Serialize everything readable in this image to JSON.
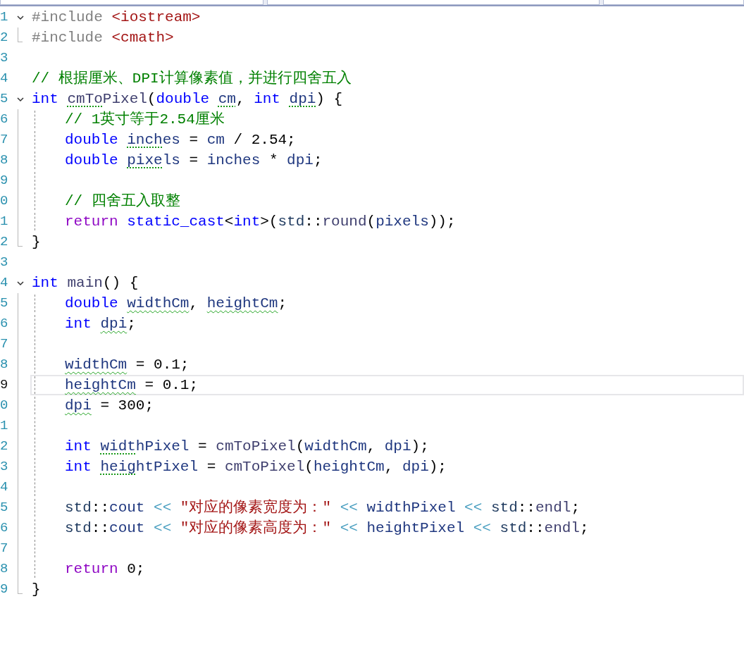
{
  "lines": [
    {
      "number": "1",
      "current": false,
      "expanded": true,
      "tokens": [
        {
          "kind": "pre",
          "text": "#include "
        },
        {
          "kind": "inc",
          "text": "<iostream>"
        }
      ],
      "children": [
        {
          "number": "2",
          "current": false,
          "tokens": [
            {
              "kind": "pre",
              "text": "#include "
            },
            {
              "kind": "inc",
              "text": "<cmath>"
            }
          ]
        }
      ]
    },
    {
      "number": "3",
      "current": false
    },
    {
      "number": "4",
      "current": false,
      "tokens": [
        {
          "kind": "cmt",
          "text": "// 根据厘米、DPI计算像素值，并进行四舍五入"
        }
      ]
    },
    {
      "number": "5",
      "current": false,
      "expanded": true,
      "tokens": [
        {
          "kind": "kw",
          "text": "int "
        },
        {
          "kind": "fn",
          "text": "cmTo",
          "hint": true
        },
        {
          "kind": "fn",
          "text": "Pixel"
        },
        {
          "kind": "plain",
          "text": "("
        },
        {
          "kind": "kw",
          "text": "double "
        },
        {
          "kind": "var",
          "text": "cm",
          "hint": true
        },
        {
          "kind": "plain",
          "text": ", "
        },
        {
          "kind": "kw",
          "text": "int "
        },
        {
          "kind": "var",
          "text": "dpi",
          "hint": true
        },
        {
          "kind": "plain",
          "text": ") {"
        }
      ],
      "body": [
        {
          "number": "6",
          "current": false,
          "tokens": [
            {
              "kind": "cmt",
              "text": "// 1英寸等于2.54厘米"
            }
          ]
        },
        {
          "number": "7",
          "current": false,
          "tokens": [
            {
              "kind": "kw",
              "text": "double "
            },
            {
              "kind": "var",
              "text": "inch",
              "hint": true
            },
            {
              "kind": "var",
              "text": "es"
            },
            {
              "kind": "plain",
              "text": " = "
            },
            {
              "kind": "var",
              "text": "cm"
            },
            {
              "kind": "plain",
              "text": " / 2.54;"
            }
          ]
        },
        {
          "number": "8",
          "current": false,
          "tokens": [
            {
              "kind": "kw",
              "text": "double "
            },
            {
              "kind": "var",
              "text": "pixe",
              "hint": true
            },
            {
              "kind": "var",
              "text": "ls"
            },
            {
              "kind": "plain",
              "text": " = "
            },
            {
              "kind": "var",
              "text": "inches"
            },
            {
              "kind": "plain",
              "text": " * "
            },
            {
              "kind": "var",
              "text": "dpi"
            },
            {
              "kind": "plain",
              "text": ";"
            }
          ]
        },
        {
          "number": "9",
          "current": false
        },
        {
          "number": "0",
          "current": false,
          "tokens": [
            {
              "kind": "cmt",
              "text": "// 四舍五入取整"
            }
          ]
        },
        {
          "number": "1",
          "current": false,
          "tokens": [
            {
              "kind": "ret",
              "text": "return "
            },
            {
              "kind": "kw",
              "text": "static_cast"
            },
            {
              "kind": "plain",
              "text": "<"
            },
            {
              "kind": "kw",
              "text": "int"
            },
            {
              "kind": "plain",
              "text": ">("
            },
            {
              "kind": "ns",
              "text": "std"
            },
            {
              "kind": "plain",
              "text": "::"
            },
            {
              "kind": "fn",
              "text": "round"
            },
            {
              "kind": "plain",
              "text": "("
            },
            {
              "kind": "var",
              "text": "pixels"
            },
            {
              "kind": "plain",
              "text": "));"
            }
          ]
        }
      ],
      "end": {
        "number": "2",
        "current": false,
        "tokens": [
          {
            "kind": "plain",
            "text": "}"
          }
        ]
      }
    },
    {
      "number": "3",
      "current": false
    },
    {
      "number": "4",
      "current": false,
      "expanded": true,
      "tokens": [
        {
          "kind": "kw",
          "text": "int "
        },
        {
          "kind": "fn",
          "text": "main"
        },
        {
          "kind": "plain",
          "text": "() {"
        }
      ],
      "body": [
        {
          "number": "5",
          "current": false,
          "tokens": [
            {
              "kind": "kw",
              "text": "double "
            },
            {
              "kind": "var",
              "text": "widthCm",
              "warning": true
            },
            {
              "kind": "plain",
              "text": ", "
            },
            {
              "kind": "var",
              "text": "heightCm",
              "warning": true
            },
            {
              "kind": "plain",
              "text": ";"
            }
          ]
        },
        {
          "number": "6",
          "current": false,
          "tokens": [
            {
              "kind": "kw",
              "text": "int "
            },
            {
              "kind": "var",
              "text": "dpi",
              "warning": true
            },
            {
              "kind": "plain",
              "text": ";"
            }
          ]
        },
        {
          "number": "7",
          "current": false
        },
        {
          "number": "8",
          "current": false,
          "tokens": [
            {
              "kind": "var",
              "text": "widthCm",
              "warning": true
            },
            {
              "kind": "plain",
              "text": " = 0.1;"
            }
          ]
        },
        {
          "number": "9",
          "current": true,
          "tokens": [
            {
              "kind": "var",
              "text": "heightCm",
              "warning": true
            },
            {
              "kind": "plain",
              "text": " = 0.1;"
            }
          ]
        },
        {
          "number": "0",
          "current": false,
          "tokens": [
            {
              "kind": "var",
              "text": "dpi",
              "warning": true
            },
            {
              "kind": "plain",
              "text": " = 300;"
            }
          ]
        },
        {
          "number": "1",
          "current": false
        },
        {
          "number": "2",
          "current": false,
          "tokens": [
            {
              "kind": "kw",
              "text": "int "
            },
            {
              "kind": "var",
              "text": "widt",
              "hint": true
            },
            {
              "kind": "var",
              "text": "hPixel"
            },
            {
              "kind": "plain",
              "text": " = "
            },
            {
              "kind": "fn",
              "text": "cmToPixel"
            },
            {
              "kind": "plain",
              "text": "("
            },
            {
              "kind": "var",
              "text": "widthCm"
            },
            {
              "kind": "plain",
              "text": ", "
            },
            {
              "kind": "var",
              "text": "dpi"
            },
            {
              "kind": "plain",
              "text": ");"
            }
          ]
        },
        {
          "number": "3",
          "current": false,
          "tokens": [
            {
              "kind": "kw",
              "text": "int "
            },
            {
              "kind": "var",
              "text": "heig",
              "hint": true
            },
            {
              "kind": "var",
              "text": "htPixel"
            },
            {
              "kind": "plain",
              "text": " = "
            },
            {
              "kind": "fn",
              "text": "cmToPixel"
            },
            {
              "kind": "plain",
              "text": "("
            },
            {
              "kind": "var",
              "text": "heightCm"
            },
            {
              "kind": "plain",
              "text": ", "
            },
            {
              "kind": "var",
              "text": "dpi"
            },
            {
              "kind": "plain",
              "text": ");"
            }
          ]
        },
        {
          "number": "4",
          "current": false
        },
        {
          "number": "5",
          "current": false,
          "tokens": [
            {
              "kind": "ns",
              "text": "std"
            },
            {
              "kind": "plain",
              "text": "::"
            },
            {
              "kind": "var",
              "text": "cout "
            },
            {
              "kind": "op",
              "text": "<< "
            },
            {
              "kind": "str",
              "text": "\"对应的像素宽度为：\" "
            },
            {
              "kind": "op",
              "text": "<< "
            },
            {
              "kind": "var",
              "text": "widthPixel "
            },
            {
              "kind": "op",
              "text": "<< "
            },
            {
              "kind": "ns",
              "text": "std"
            },
            {
              "kind": "plain",
              "text": "::"
            },
            {
              "kind": "fn",
              "text": "endl"
            },
            {
              "kind": "plain",
              "text": ";"
            }
          ]
        },
        {
          "number": "6",
          "current": false,
          "tokens": [
            {
              "kind": "ns",
              "text": "std"
            },
            {
              "kind": "plain",
              "text": "::"
            },
            {
              "kind": "var",
              "text": "cout "
            },
            {
              "kind": "op",
              "text": "<< "
            },
            {
              "kind": "str",
              "text": "\"对应的像素高度为：\" "
            },
            {
              "kind": "op",
              "text": "<< "
            },
            {
              "kind": "var",
              "text": "heightPixel "
            },
            {
              "kind": "op",
              "text": "<< "
            },
            {
              "kind": "ns",
              "text": "std"
            },
            {
              "kind": "plain",
              "text": "::"
            },
            {
              "kind": "fn",
              "text": "endl"
            },
            {
              "kind": "plain",
              "text": ";"
            }
          ]
        },
        {
          "number": "7",
          "current": false
        },
        {
          "number": "8",
          "current": false,
          "tokens": [
            {
              "kind": "ret",
              "text": "return "
            },
            {
              "kind": "plain",
              "text": "0;"
            }
          ]
        }
      ],
      "end": {
        "number": "9",
        "current": false,
        "tokens": [
          {
            "kind": "plain",
            "text": "}"
          }
        ]
      }
    }
  ]
}
